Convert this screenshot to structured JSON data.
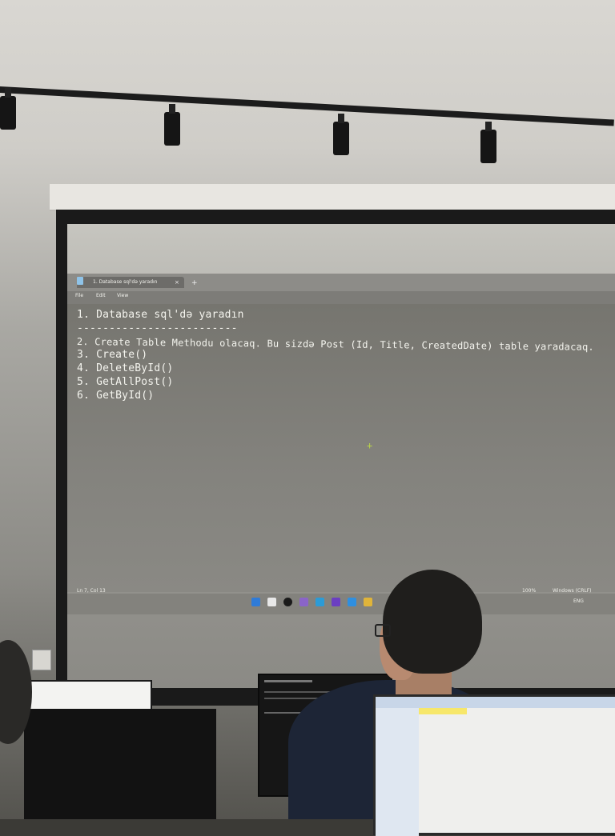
{
  "window": {
    "tab_title": "1. Database sql'də yaradın",
    "tab_close": "×",
    "tab_add": "+",
    "menu": [
      "File",
      "Edit",
      "View"
    ]
  },
  "editor": {
    "lines": [
      "1. Database sql'də yaradın",
      "-------------------------",
      "2. Create Table Methodu olacaq. Bu sizdə Post (Id, Title, CreatedDate) table yaradacaq.",
      "3. Create()",
      "4. DeleteById()",
      "5. GetAllPost()",
      "6. GetById()"
    ]
  },
  "status": {
    "position": "Ln 7, Col 13",
    "zoom": "100%",
    "line_ending": "Windows (CRLF)",
    "tray_lang": "ENG"
  },
  "colors": {
    "screen_text": "#f4f4ee",
    "cursor_mark": "#b9d34a"
  }
}
